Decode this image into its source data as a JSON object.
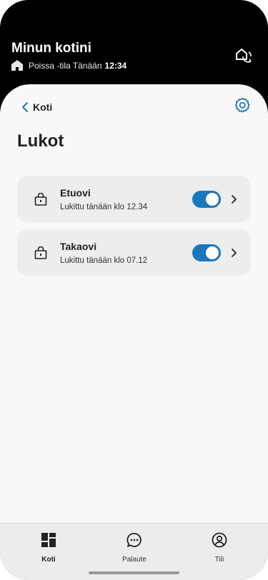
{
  "header": {
    "home_title": "Minun kotini",
    "mode_text": "Poissa -tila Tänään",
    "time": "12:34"
  },
  "nav": {
    "back_label": "Koti"
  },
  "page": {
    "title": "Lukot"
  },
  "locks": [
    {
      "name": "Etuovi",
      "status": "Lukittu tänään klo 12.34",
      "locked": true
    },
    {
      "name": "Takaovi",
      "status": "Lukittu tänään klo 07.12",
      "locked": true
    }
  ],
  "tabbar": {
    "tabs": [
      {
        "label": "Koti",
        "icon": "dashboard-icon",
        "active": true
      },
      {
        "label": "Palaute",
        "icon": "chat-bubble-icon",
        "active": false
      },
      {
        "label": "Tili",
        "icon": "user-circle-icon",
        "active": false
      }
    ]
  },
  "colors": {
    "accent": "#1a77bd",
    "header_bg": "#000000",
    "sheet_bg": "#f9f7f8",
    "card_bg": "#ededed"
  }
}
